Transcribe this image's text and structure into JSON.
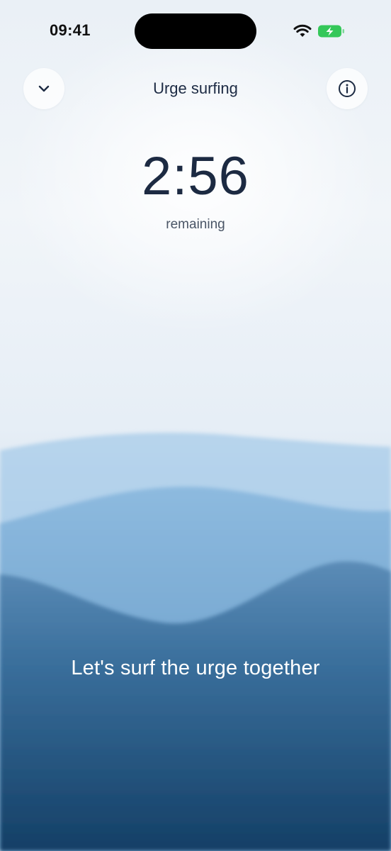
{
  "status_bar": {
    "time": "09:41",
    "icons": [
      "wifi-icon",
      "battery-charging-icon"
    ],
    "battery_color": "#34c759"
  },
  "header": {
    "title": "Urge surfing",
    "left_icon": "chevron-down-icon",
    "right_icon": "info-icon"
  },
  "timer": {
    "value": "2:56",
    "caption": "remaining"
  },
  "message": "Let's surf the urge together",
  "colors": {
    "text_dark": "#1c2a42",
    "wave_light": "#b5d3ea",
    "wave_mid": "#7fb0d6",
    "wave_deep": "#1a4a74"
  }
}
